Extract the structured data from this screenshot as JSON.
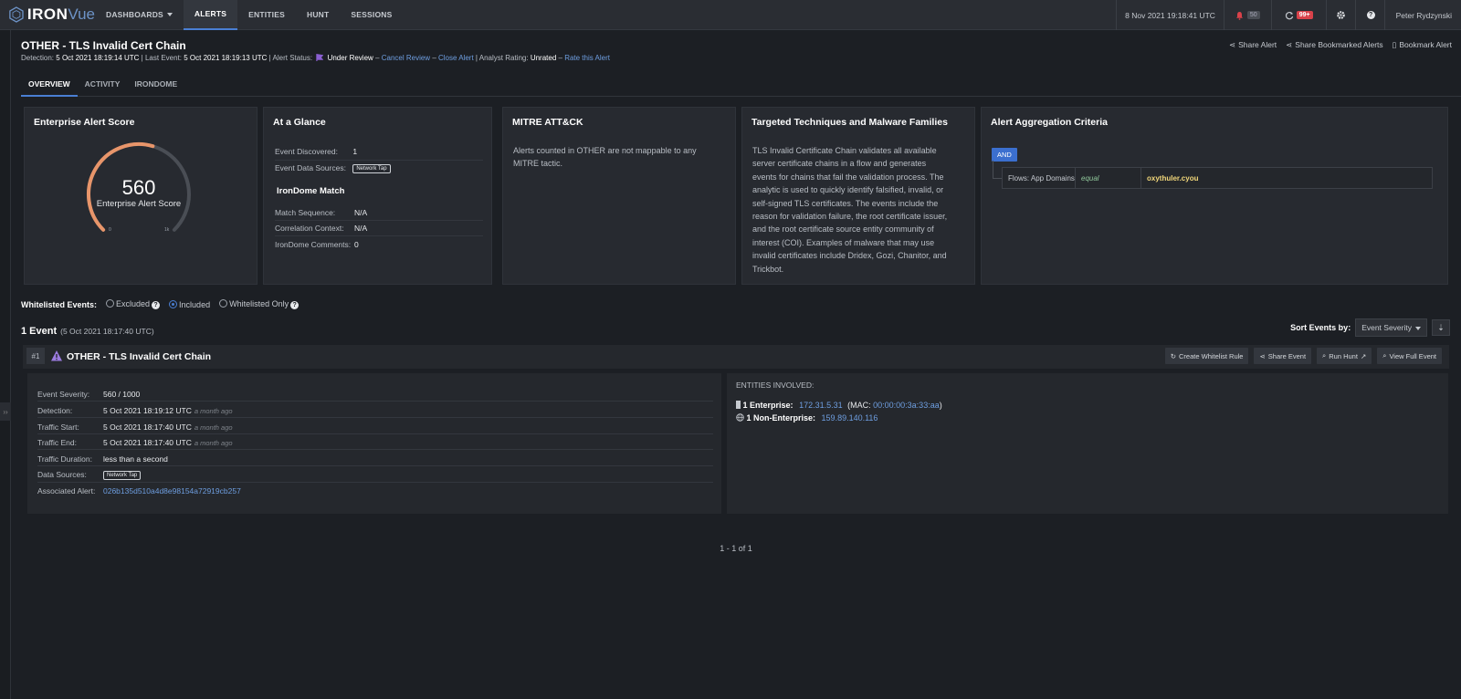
{
  "brand": {
    "part1": "IRON",
    "part2": "Vue"
  },
  "nav": [
    {
      "label": "DASHBOARDS"
    },
    {
      "label": "ALERTS"
    },
    {
      "label": "ENTITIES"
    },
    {
      "label": "HUNT"
    },
    {
      "label": "SESSIONS"
    }
  ],
  "topbar": {
    "datetime": "8 Nov 2021 19:18:41 UTC",
    "alert_count": "50",
    "refresh_count": "99+",
    "user": "Peter Rydzynski"
  },
  "alert": {
    "title": "OTHER - TLS Invalid Cert Chain",
    "detection_label": "Detection:",
    "detection": "5 Oct 2021 18:19:14 UTC",
    "last_event_label": "Last Event:",
    "last_event": "5 Oct 2021 18:19:13 UTC",
    "status_label": "Alert Status:",
    "status": "Under Review",
    "cancel_review": "Cancel Review",
    "close_alert": "Close Alert",
    "rating_label": "Analyst Rating:",
    "rating": "Unrated",
    "rate_link": "Rate this Alert"
  },
  "header_actions": {
    "share": "Share Alert",
    "share_bookmarked": "Share Bookmarked Alerts",
    "bookmark": "Bookmark Alert"
  },
  "tabs": [
    {
      "label": "OVERVIEW"
    },
    {
      "label": "ACTIVITY"
    },
    {
      "label": "IRONDOME"
    }
  ],
  "score_card": {
    "title": "Enterprise Alert Score",
    "score": "560",
    "label": "Enterprise Alert Score",
    "min": "0",
    "max": "1k",
    "fraction": 0.56
  },
  "glance": {
    "title": "At a Glance",
    "discovered_label": "Event Discovered:",
    "discovered": "1",
    "sources_label": "Event Data Sources:",
    "source_pill": "Network Tap",
    "irondome_title": "IronDome Match",
    "match_seq_label": "Match Sequence:",
    "match_seq": "N/A",
    "corr_label": "Correlation Context:",
    "corr": "N/A",
    "comments_label": "IronDome Comments:",
    "comments": "0"
  },
  "mitre": {
    "title": "MITRE ATT&CK",
    "text_line1": "Alerts counted in OTHER are not mappable to any",
    "text_line2": "MITRE tactic."
  },
  "techniques": {
    "title": "Targeted Techniques and Malware Families",
    "lines": [
      "TLS Invalid Certificate Chain validates all available",
      "server certificate chains in a flow and generates",
      "events for chains that fail the validation process. The",
      "analytic is used to quickly identify falsified, invalid, or",
      "self-signed TLS certificates. The events include the",
      "reason for validation failure, the root certificate issuer,",
      "and the root certificate source entity community of",
      "interest (COI). Examples of malware that may use",
      "invalid certificates include Dridex, Gozi, Chanitor, and",
      "Trickbot."
    ]
  },
  "aggregation": {
    "title": "Alert Aggregation Criteria",
    "op": "AND",
    "field": "Flows: App Domains",
    "cmp": "equal",
    "value": "oxythuler.cyou"
  },
  "whitelist": {
    "label": "Whitelisted Events:",
    "opt1": "Excluded",
    "opt2": "Included",
    "opt3": "Whitelisted Only"
  },
  "events": {
    "count_label": "1 Event",
    "range": "(5 Oct 2021 18:17:40 UTC)",
    "sort_label": "Sort Events by:",
    "sort_value": "Event Severity"
  },
  "event": {
    "num": "#1",
    "title": "OTHER - TLS Invalid Cert Chain",
    "btn_whitelist": "Create Whitelist Rule",
    "btn_share": "Share Event",
    "btn_hunt": "Run Hunt",
    "btn_view": "View Full Event",
    "severity_label": "Event Severity:",
    "severity": "560 / 1000",
    "detection_label": "Detection:",
    "detection": "5 Oct 2021 18:19:12 UTC",
    "start_label": "Traffic Start:",
    "start": "5 Oct 2021 18:17:40 UTC",
    "end_label": "Traffic End:",
    "end": "5 Oct 2021 18:17:40 UTC",
    "ago": "a month ago",
    "duration_label": "Traffic Duration:",
    "duration": "less than a second",
    "sources_label": "Data Sources:",
    "source_pill": "Network Tap",
    "assoc_label": "Associated Alert:",
    "assoc": "026b135d510a4d8e98154a72919cb257",
    "entities_title": "ENTITIES INVOLVED:",
    "ent1_label": "1 Enterprise:",
    "ent1_ip": "172.31.5.31",
    "ent1_mac_label": "(MAC:",
    "ent1_mac": "00:00:00:3a:33:aa",
    "ent1_close": ")",
    "ent2_label": "1 Non-Enterprise:",
    "ent2_ip": "159.89.140.116"
  },
  "pager": "1 - 1 of 1",
  "colors": {
    "accent": "#4a7fd4",
    "gauge": "#e8956a",
    "link": "#6e9ee0",
    "badge": "#d9424a"
  }
}
